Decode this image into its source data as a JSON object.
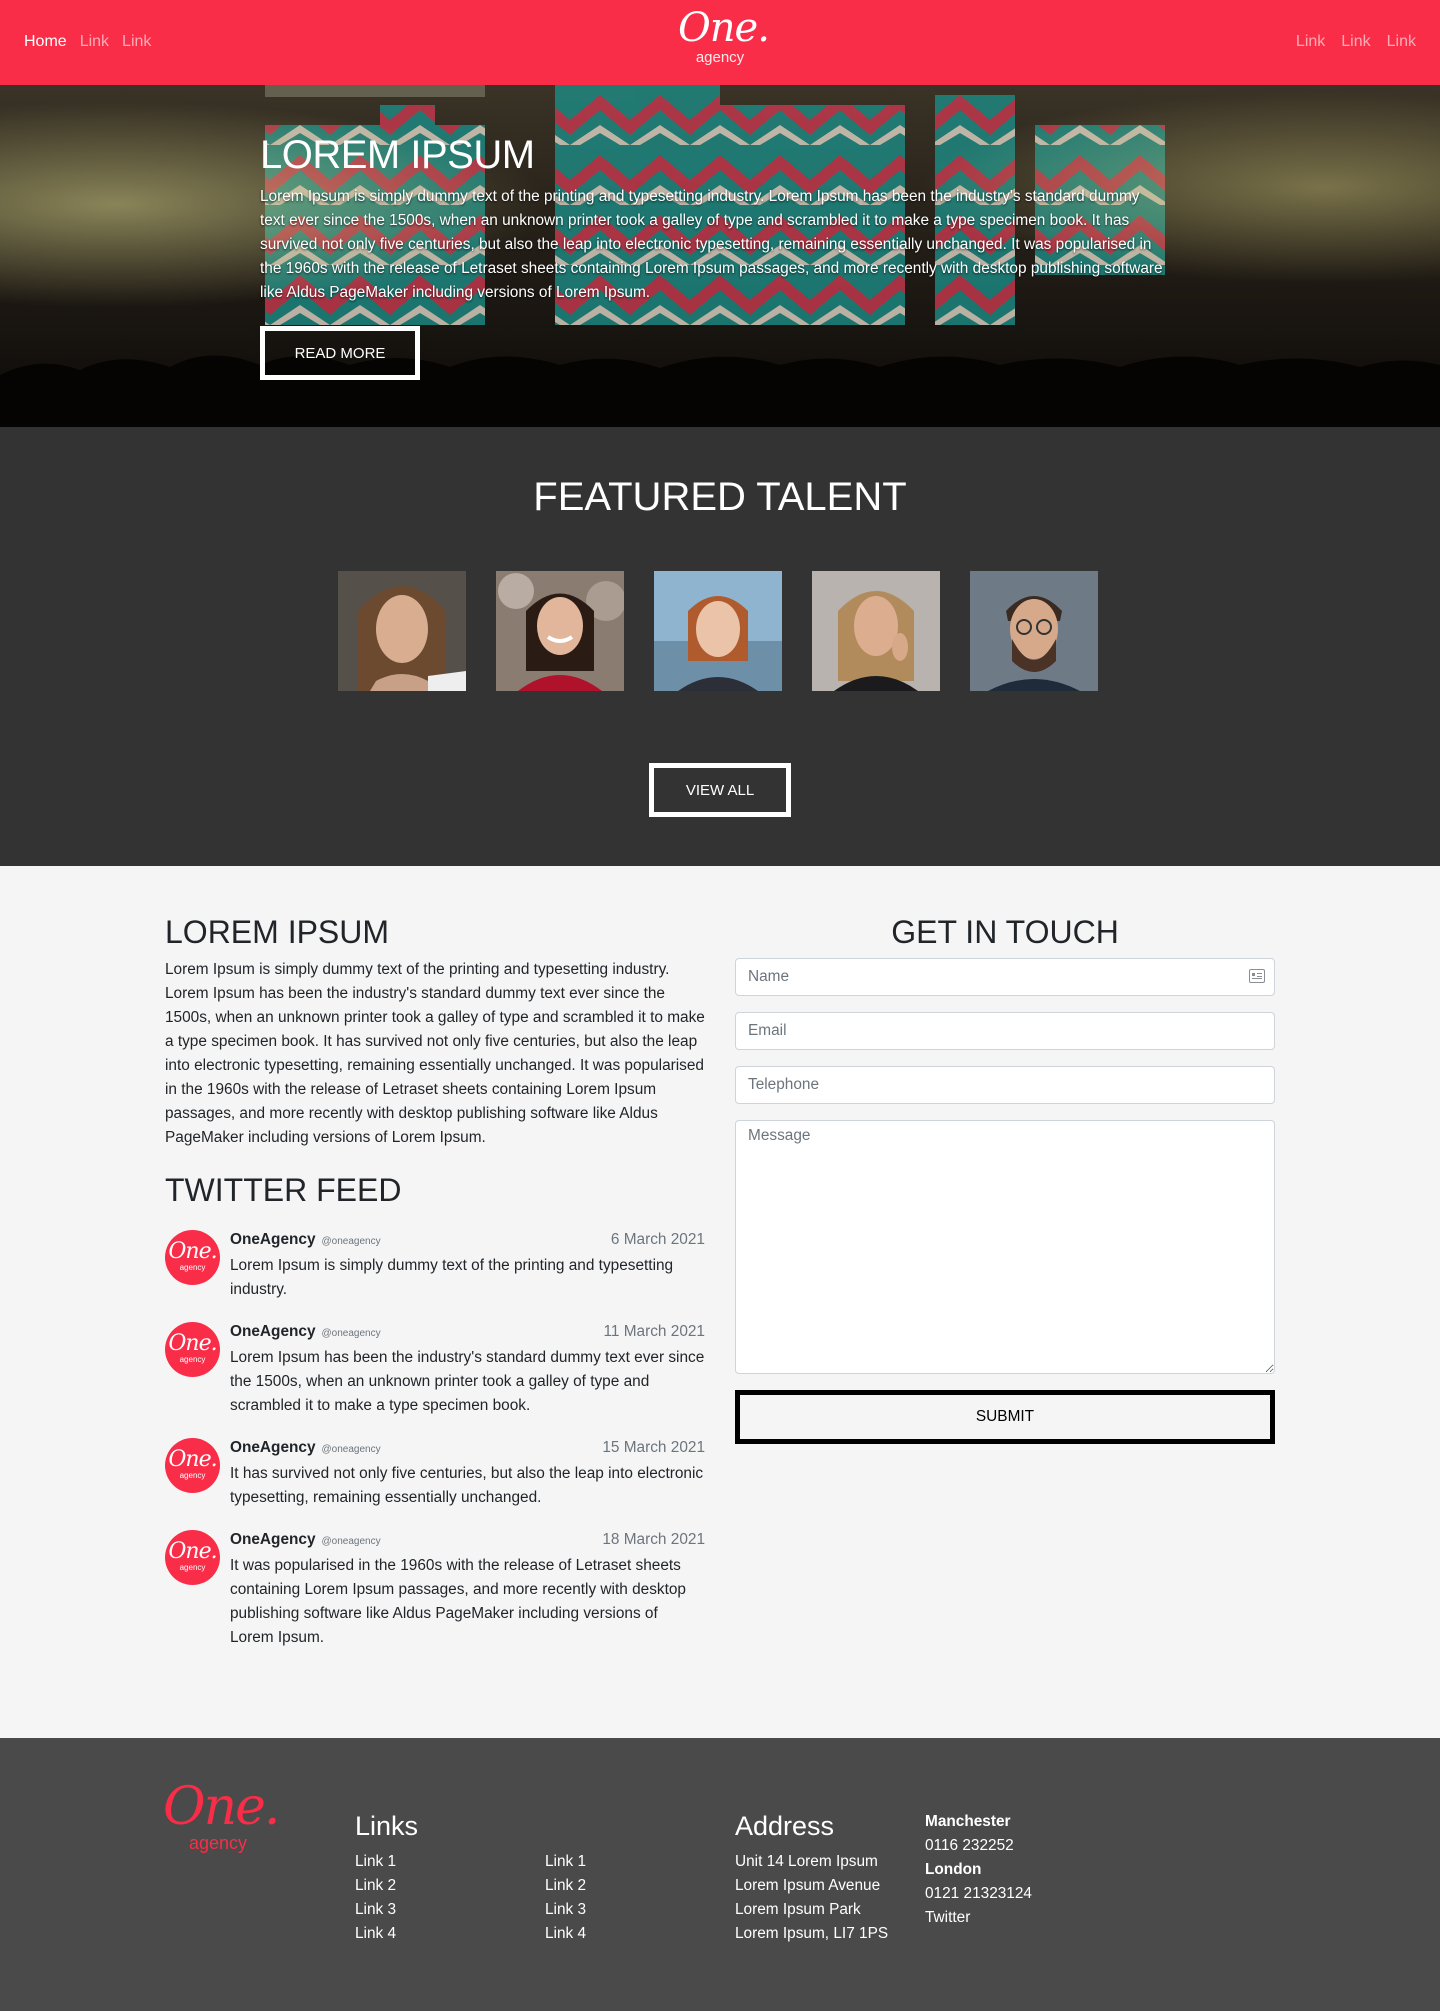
{
  "nav": {
    "left": [
      "Home",
      "Link",
      "Link"
    ],
    "right": [
      "Link",
      "Link",
      "Link"
    ],
    "brand": {
      "one": "One.",
      "agency": "agency"
    }
  },
  "hero": {
    "title": "LOREM IPSUM",
    "text": "Lorem Ipsum is simply dummy text of the printing and typesetting industry. Lorem Ipsum has been the industry's standard dummy text ever since the 1500s, when an unknown printer took a galley of type and scrambled it to make a type specimen book. It has survived not only five centuries, but also the leap into electronic typesetting, remaining essentially unchanged. It was popularised in the 1960s with the release of Letraset sheets containing Lorem Ipsum passages, and more recently with desktop publishing software like Aldus PageMaker including versions of Lorem Ipsum.",
    "button": "READ MORE"
  },
  "featured": {
    "title": "FEATURED TALENT",
    "button": "VIEW ALL"
  },
  "about": {
    "title": "LOREM IPSUM",
    "text": "Lorem Ipsum is simply dummy text of the printing and typesetting industry. Lorem Ipsum has been the industry's standard dummy text ever since the 1500s, when an unknown printer took a galley of type and scrambled it to make a type specimen book. It has survived not only five centuries, but also the leap into electronic typesetting, remaining essentially unchanged. It was popularised in the 1960s with the release of Letraset sheets containing Lorem Ipsum passages, and more recently with desktop publishing software like Aldus PageMaker including versions of Lorem Ipsum."
  },
  "twitter": {
    "title": "TWITTER FEED",
    "avatar": {
      "one": "One.",
      "agency": "agency"
    },
    "tweets": [
      {
        "name": "OneAgency",
        "handle": "@oneagency",
        "date": "6 March 2021",
        "text": "Lorem Ipsum is simply dummy text of the printing and typesetting industry."
      },
      {
        "name": "OneAgency",
        "handle": "@oneagency",
        "date": "11 March 2021",
        "text": "Lorem Ipsum has been the industry's standard dummy text ever since the 1500s, when an unknown printer took a galley of type and scrambled it to make a type specimen book."
      },
      {
        "name": "OneAgency",
        "handle": "@oneagency",
        "date": "15 March 2021",
        "text": "It has survived not only five centuries, but also the leap into electronic typesetting, remaining essentially unchanged."
      },
      {
        "name": "OneAgency",
        "handle": "@oneagency",
        "date": "18 March 2021",
        "text": "It was popularised in the 1960s with the release of Letraset sheets containing Lorem Ipsum passages, and more recently with desktop publishing software like Aldus PageMaker including versions of Lorem Ipsum."
      }
    ]
  },
  "contact": {
    "title": "GET IN TOUCH",
    "name_placeholder": "Name",
    "email_placeholder": "Email",
    "telephone_placeholder": "Telephone",
    "message_placeholder": "Message",
    "submit": "SUBMIT"
  },
  "footer": {
    "logo": {
      "one": "One.",
      "agency": "agency"
    },
    "links_title": "Links",
    "links_col1": [
      "Link 1",
      "Link 2",
      "Link 3",
      "Link 4"
    ],
    "links_col2": [
      "Link 1",
      "Link 2",
      "Link 3",
      "Link 4"
    ],
    "address_title": "Address",
    "address": [
      "Unit 14 Lorem Ipsum",
      "Lorem Ipsum Avenue",
      "Lorem Ipsum Park",
      "Lorem Ipsum, LI7 1PS"
    ],
    "manchester_label": "Manchester",
    "manchester_phone": "0116 232252",
    "london_label": "London",
    "london_phone": "0121 21323124",
    "twitter": "Twitter"
  },
  "colors": {
    "brand": "#fa2d48",
    "dark": "#333333",
    "footer": "#4a4a4a"
  }
}
